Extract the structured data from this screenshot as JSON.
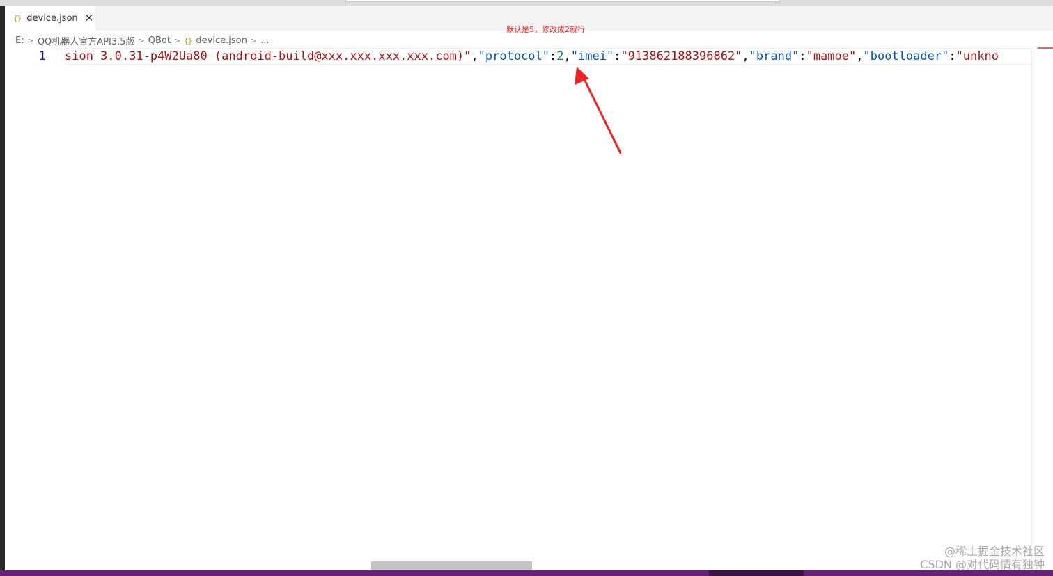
{
  "tab": {
    "icon": "json-braces-icon",
    "icon_text": "{}",
    "label": "device.json",
    "close_label": "✕"
  },
  "breadcrumb": {
    "items": [
      "E:",
      "QQ机器人官方API3.5版",
      "QBot",
      "device.json",
      "..."
    ],
    "separator": ">",
    "file_icon": "{}"
  },
  "annotation": {
    "text": "默认是5，修改成2就行",
    "color": "#ee2222"
  },
  "editor": {
    "line_number": "1",
    "tokens": [
      {
        "type": "str",
        "text": "sion 3.0.31-p4W2Ua80 (android-build@xxx.xxx.xxx.xxx.com)\""
      },
      {
        "type": "punct",
        "text": ","
      },
      {
        "type": "key",
        "text": "\"protocol\""
      },
      {
        "type": "punct",
        "text": ":"
      },
      {
        "type": "num",
        "text": "2"
      },
      {
        "type": "punct",
        "text": ","
      },
      {
        "type": "key",
        "text": "\"imei\""
      },
      {
        "type": "punct",
        "text": ":"
      },
      {
        "type": "str",
        "text": "\"913862188396862\""
      },
      {
        "type": "punct",
        "text": ","
      },
      {
        "type": "key",
        "text": "\"brand\""
      },
      {
        "type": "punct",
        "text": ":"
      },
      {
        "type": "str",
        "text": "\"mamoe\""
      },
      {
        "type": "punct",
        "text": ","
      },
      {
        "type": "key",
        "text": "\"bootloader\""
      },
      {
        "type": "punct",
        "text": ":"
      },
      {
        "type": "str",
        "text": "\"unkno"
      }
    ]
  },
  "watermark": {
    "line1": "@稀土掘金技术社区",
    "line2": "CSDN @对代码情有独钟"
  },
  "colors": {
    "status_bar": "#68217a",
    "string": "#a31515",
    "key": "#0451a5",
    "number": "#098658",
    "arrow": "#ee2222"
  }
}
